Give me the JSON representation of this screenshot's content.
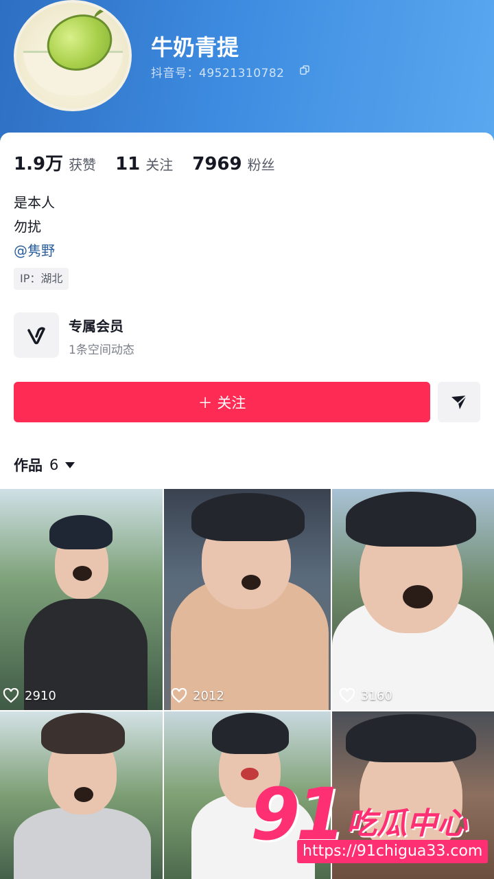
{
  "profile": {
    "nickname": "牛奶青提",
    "douyin_id": "抖音号：49521310782"
  },
  "stats": [
    {
      "value": "1.9万",
      "label": "获赞"
    },
    {
      "value": "11",
      "label": "关注"
    },
    {
      "value": "7969",
      "label": "粉丝"
    }
  ],
  "bio": {
    "line1": "是本人",
    "line2": "勿扰",
    "mention": "@隽野"
  },
  "ip_tag": "IP：湖北",
  "member": {
    "title": "专属会员",
    "subtitle": "1条空间动态"
  },
  "actions": {
    "follow_label": "＋ 关注"
  },
  "works": {
    "label": "作品",
    "count": "6",
    "items": [
      {
        "likes": "2910"
      },
      {
        "likes": "2012"
      },
      {
        "likes": "3160"
      },
      {
        "likes": ""
      },
      {
        "likes": ""
      },
      {
        "likes": ""
      }
    ]
  },
  "watermark": {
    "brand_number": "91",
    "brand_text": "吃瓜中心",
    "url": "https://91chigua33.com"
  },
  "colors": {
    "header_blue": "#3d8be0",
    "follow_red": "#fe2c55",
    "mention_blue": "#2a5e9c",
    "watermark_pink": "#ff2f74"
  },
  "icons": [
    "copy-icon",
    "member-v-icon",
    "share-send-icon",
    "heart-icon",
    "dropdown-caret-icon"
  ]
}
